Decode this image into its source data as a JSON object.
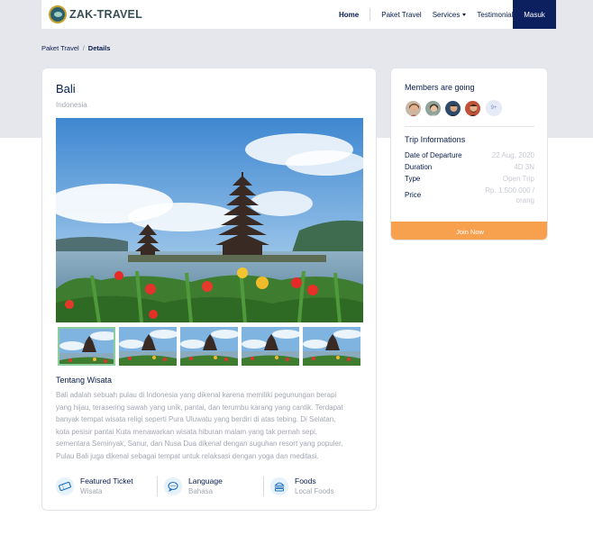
{
  "navbar": {
    "brand": "ZAK-TRAVEL",
    "links": [
      "Home",
      "Paket Travel",
      "Services",
      "Testimonial"
    ],
    "login_label": "Masuk"
  },
  "breadcrumb": {
    "parent": "Paket Travel",
    "separator": "/",
    "current": "Details"
  },
  "detail": {
    "title": "Bali",
    "location": "Indonesia",
    "gallery_count": 5,
    "active_thumbnail": 1,
    "about_title": "Tentang Wisata",
    "about_lines": [
      "Bali adalah sebuah pulau di Indonesia yang dikenal karena memiliki pegunungan berapi",
      "yang hijau, terasering sawah yang unik, pantai, dan terumbu karang yang cantik. Terdapat",
      "banyak tempat wisata religi seperti Pura Uluwatu yang berdiri di atas tebing. Di Selatan,",
      "kota pesisir pantai Kuta menawarkan wisata hiburan malam yang tak pernah sepi,",
      "sementara Seminyak, Sanur, dan Nusa Dua dikenal dengan suguhan resort yang populer.",
      "Pulau Bali juga dikenal sebagai tempat untuk relaksasi dengan yoga dan meditasi."
    ],
    "features": [
      {
        "label": "Featured Ticket",
        "value": "Wisata",
        "icon": "ticket-icon"
      },
      {
        "label": "Language",
        "value": "Bahasa",
        "icon": "speech-bubble-icon"
      },
      {
        "label": "Foods",
        "value": "Local Foods",
        "icon": "food-icon"
      }
    ]
  },
  "sidebar": {
    "members_title": "Members are going",
    "more_label": "9+",
    "info_title": "Trip Informations",
    "info": [
      {
        "label": "Date of Departure",
        "value": "22 Aug, 2020"
      },
      {
        "label": "Duration",
        "value": "4D 3N"
      },
      {
        "label": "Type",
        "value": "Open Trip"
      },
      {
        "label": "Price",
        "value": "Rp. 1.500.000 /",
        "value2": "orang"
      }
    ],
    "join_label": "Join Now"
  },
  "colors": {
    "navy": "#0c2060",
    "accent_orange": "#f7a14e",
    "band_gray": "#e6e7ec",
    "muted_text": "#a3a7b3"
  }
}
